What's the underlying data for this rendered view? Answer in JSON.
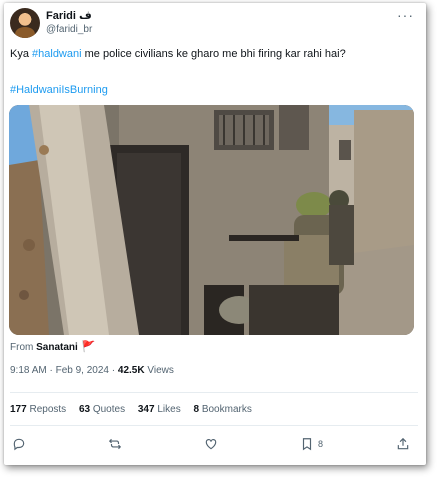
{
  "user": {
    "name": "Faridi ف",
    "handle": "@faridi_br"
  },
  "more_icon": "more-horizontal-icon",
  "tweet": {
    "text_prefix": "Kya ",
    "hashtag_1": "#haldwani",
    "text_suffix": " me police civilians ke gharo me bhi firing kar rahi hai?",
    "hashtag_2": "#HaldwaniIsBurning"
  },
  "source": {
    "label": "From",
    "name": "Sanatani",
    "flag": "🚩"
  },
  "meta": {
    "time": "9:18 AM",
    "separator": "·",
    "date": "Feb 9, 2024",
    "views_count": "42.5K",
    "views_label": "Views"
  },
  "stats": {
    "reposts_count": "177",
    "reposts_label": "Reposts",
    "quotes_count": "63",
    "quotes_label": "Quotes",
    "likes_count": "347",
    "likes_label": "Likes",
    "bookmarks_count": "8",
    "bookmarks_label": "Bookmarks"
  },
  "actions": {
    "reply_icon": "reply-icon",
    "repost_icon": "repost-icon",
    "like_icon": "heart-icon",
    "bookmark_icon": "bookmark-icon",
    "bookmark_count": "8",
    "share_icon": "share-icon"
  },
  "colors": {
    "accent": "#1d9bf0",
    "text": "#0f1419",
    "secondary": "#536471"
  }
}
